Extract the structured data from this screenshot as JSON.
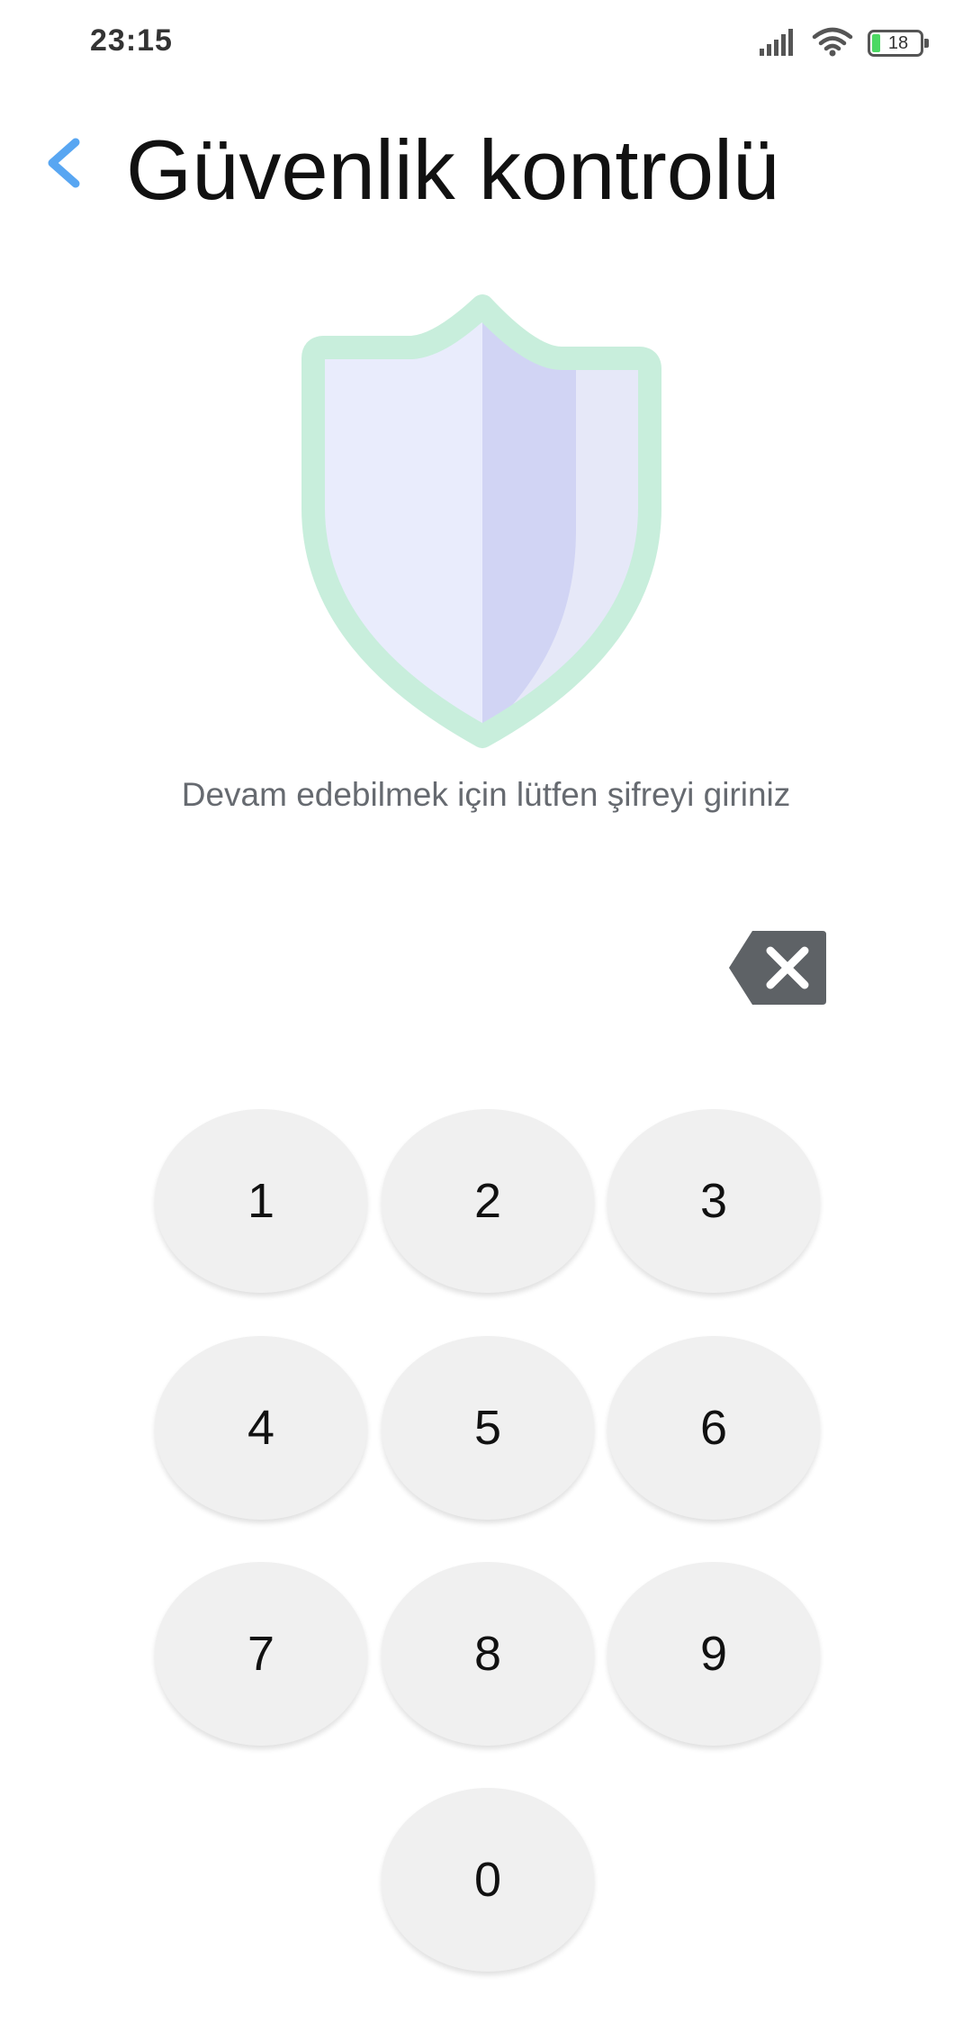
{
  "status_bar": {
    "time": "23:15",
    "battery_level": "18",
    "icons": [
      "signal-icon",
      "wifi-icon",
      "battery-icon"
    ]
  },
  "header": {
    "title": "Güvenlik kontrolü",
    "back_icon": "chevron-left-icon"
  },
  "illustration": {
    "icon": "shield-icon"
  },
  "prompt": "Devam edebilmek için lütfen şifreyi giriniz",
  "keypad": {
    "delete_icon": "backspace-icon",
    "keys": [
      "1",
      "2",
      "3",
      "4",
      "5",
      "6",
      "7",
      "8",
      "9",
      "0"
    ]
  },
  "colors": {
    "accent": "#58a6f2",
    "key_background": "#f0f0f0",
    "shield_outline": "#c8eedc",
    "shield_left": "#e8ebfc",
    "shield_mid": "#d0d4f4",
    "delete_key": "#5e6266"
  }
}
